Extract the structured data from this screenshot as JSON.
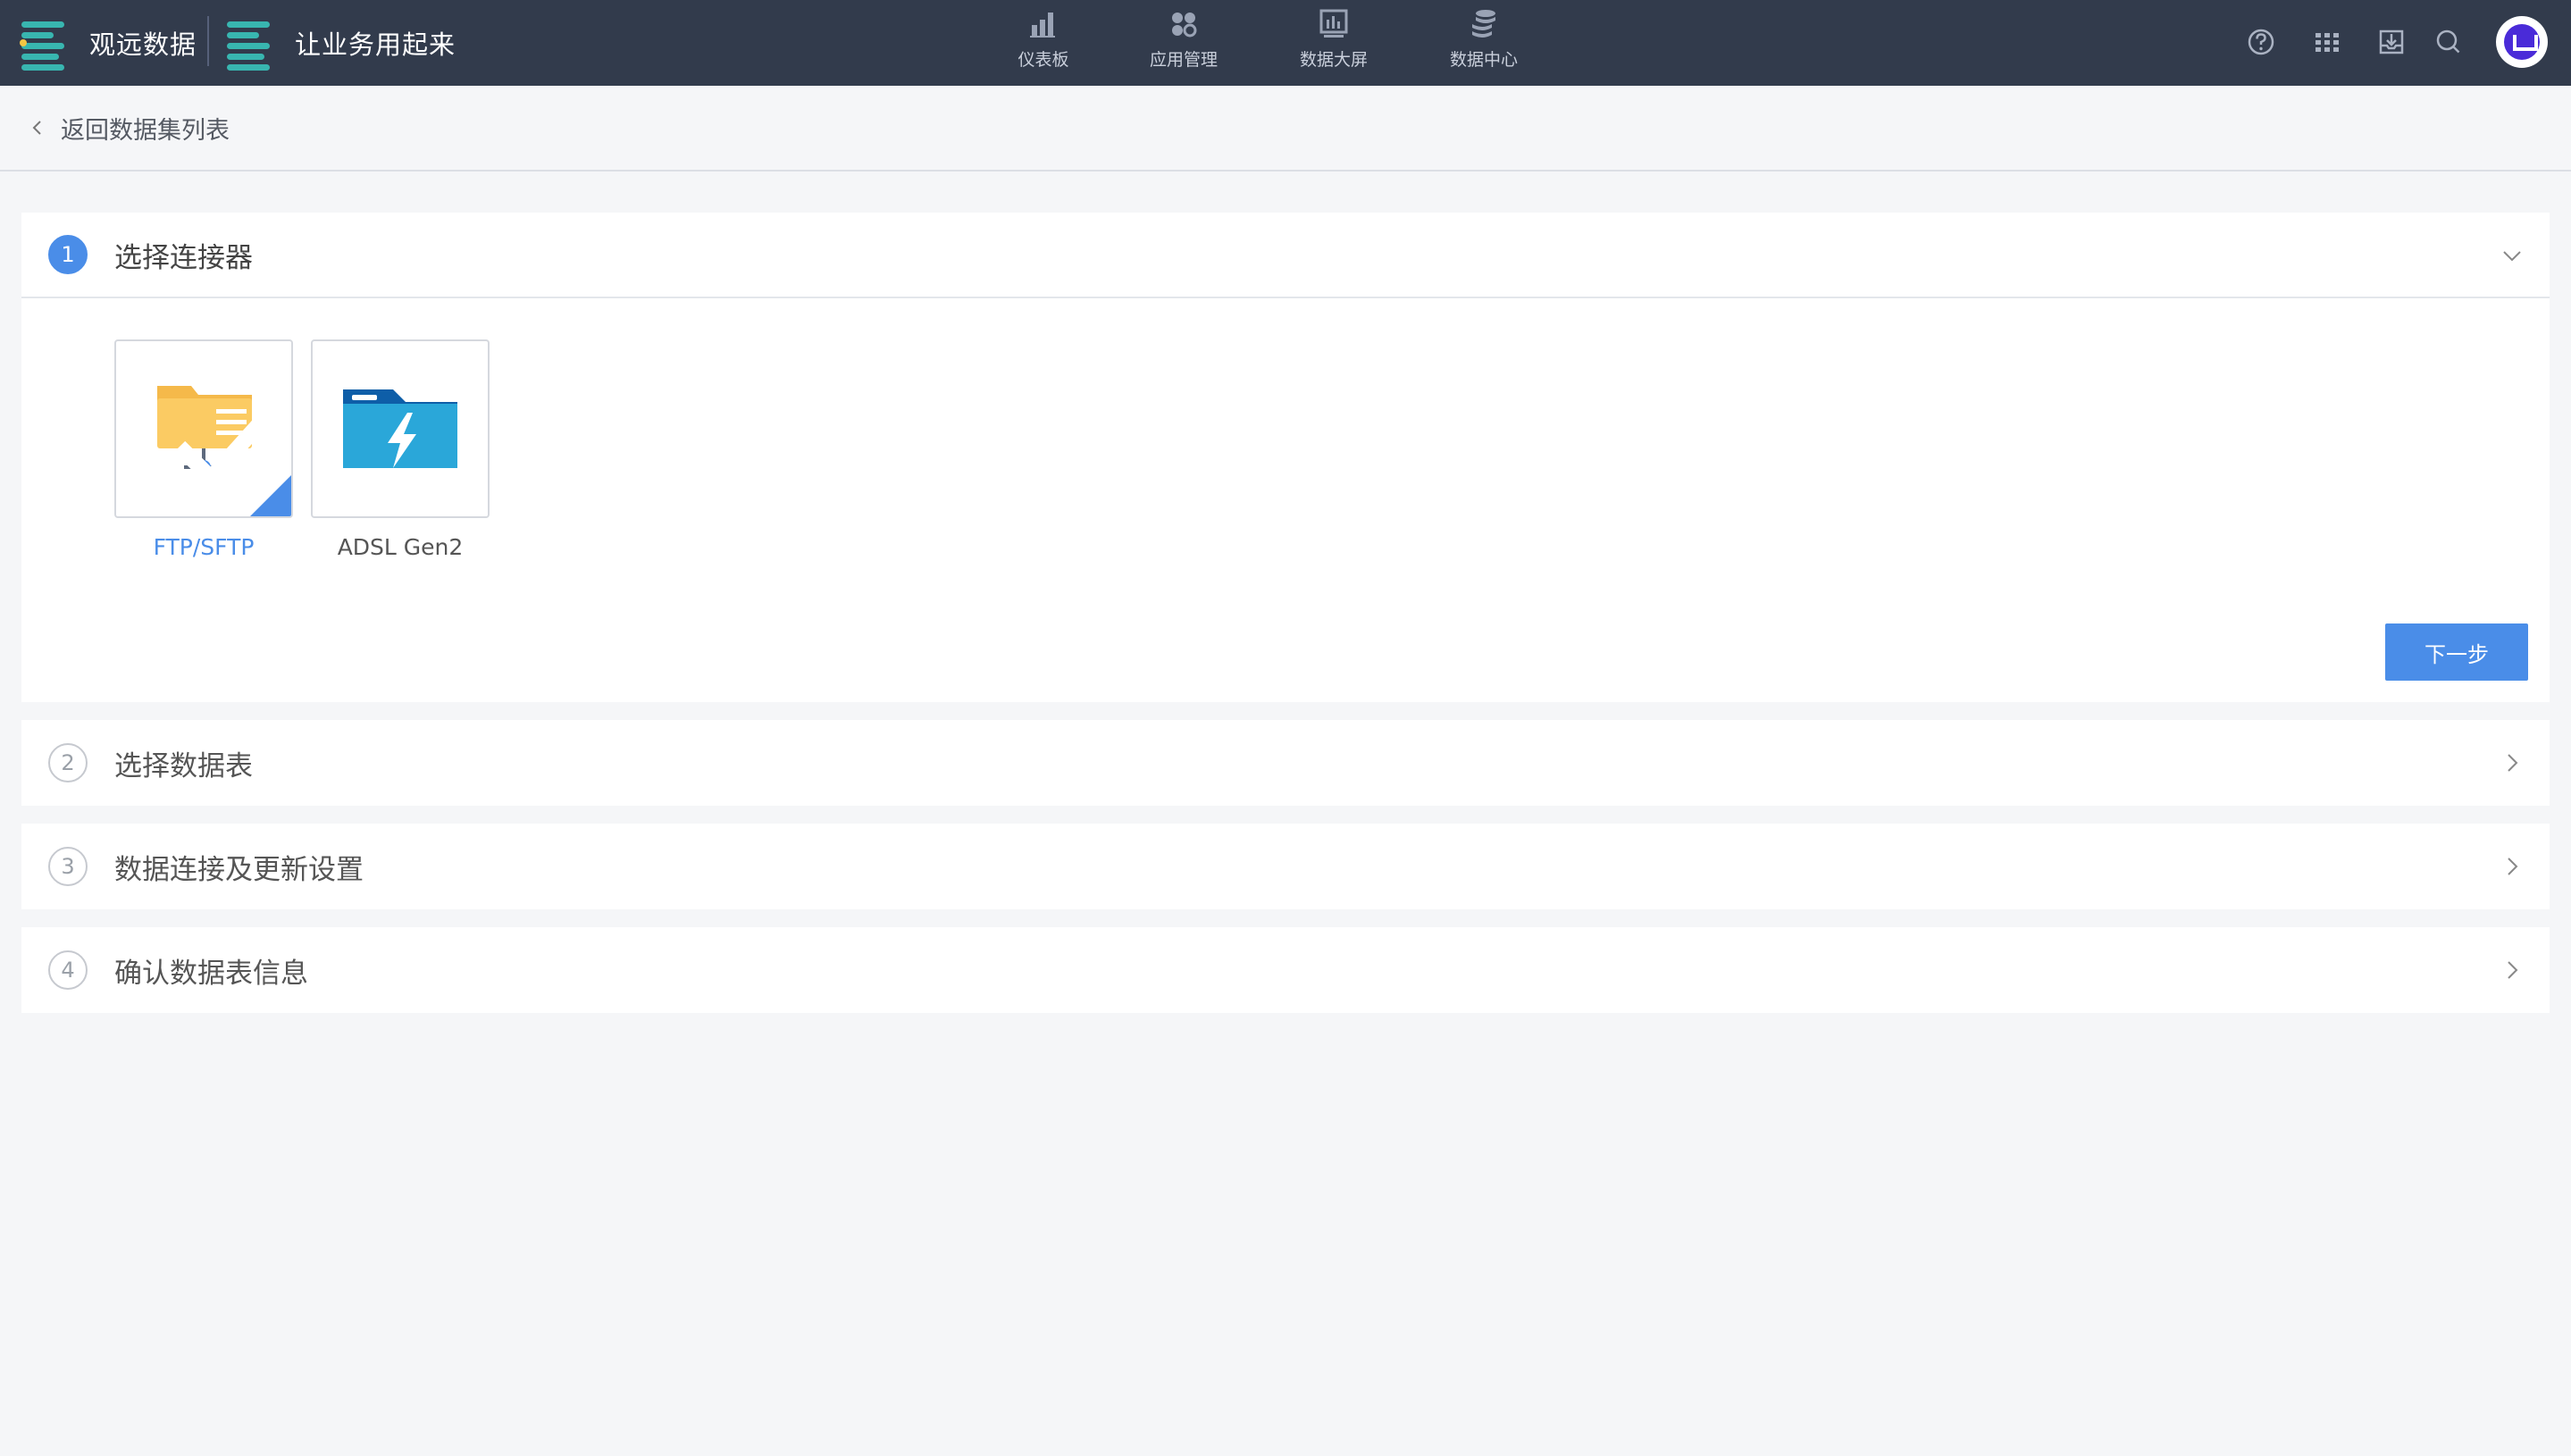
{
  "topbar": {
    "brand_name": "观远数据",
    "brand_slogan": "让业务用起来",
    "nav": [
      {
        "label": "仪表板",
        "icon": "bar-chart-icon"
      },
      {
        "label": "应用管理",
        "icon": "apps-cluster-icon"
      },
      {
        "label": "数据大屏",
        "icon": "big-screen-icon"
      },
      {
        "label": "数据中心",
        "icon": "database-stack-icon"
      }
    ],
    "tools": [
      "help-icon",
      "grid-menu-icon",
      "inbox-download-icon",
      "search-icon"
    ],
    "background_color": "#323b4c",
    "accent_color": "#38b6b0"
  },
  "back": {
    "label": "返回数据集列表"
  },
  "steps": [
    {
      "number": "1",
      "title": "选择连接器",
      "state": "expanded"
    },
    {
      "number": "2",
      "title": "选择数据表",
      "state": "collapsed"
    },
    {
      "number": "3",
      "title": "数据连接及更新设置",
      "state": "collapsed"
    },
    {
      "number": "4",
      "title": "确认数据表信息",
      "state": "collapsed"
    }
  ],
  "connectors": [
    {
      "label": "FTP/SFTP",
      "icon": "ftp-folder-icon",
      "selected": true
    },
    {
      "label": "ADSL Gen2",
      "icon": "azure-data-lake-folder-icon",
      "selected": false
    }
  ],
  "actions": {
    "next_label": "下一步"
  },
  "colors": {
    "primary": "#4a8de8",
    "page_background": "#f5f6f8"
  }
}
